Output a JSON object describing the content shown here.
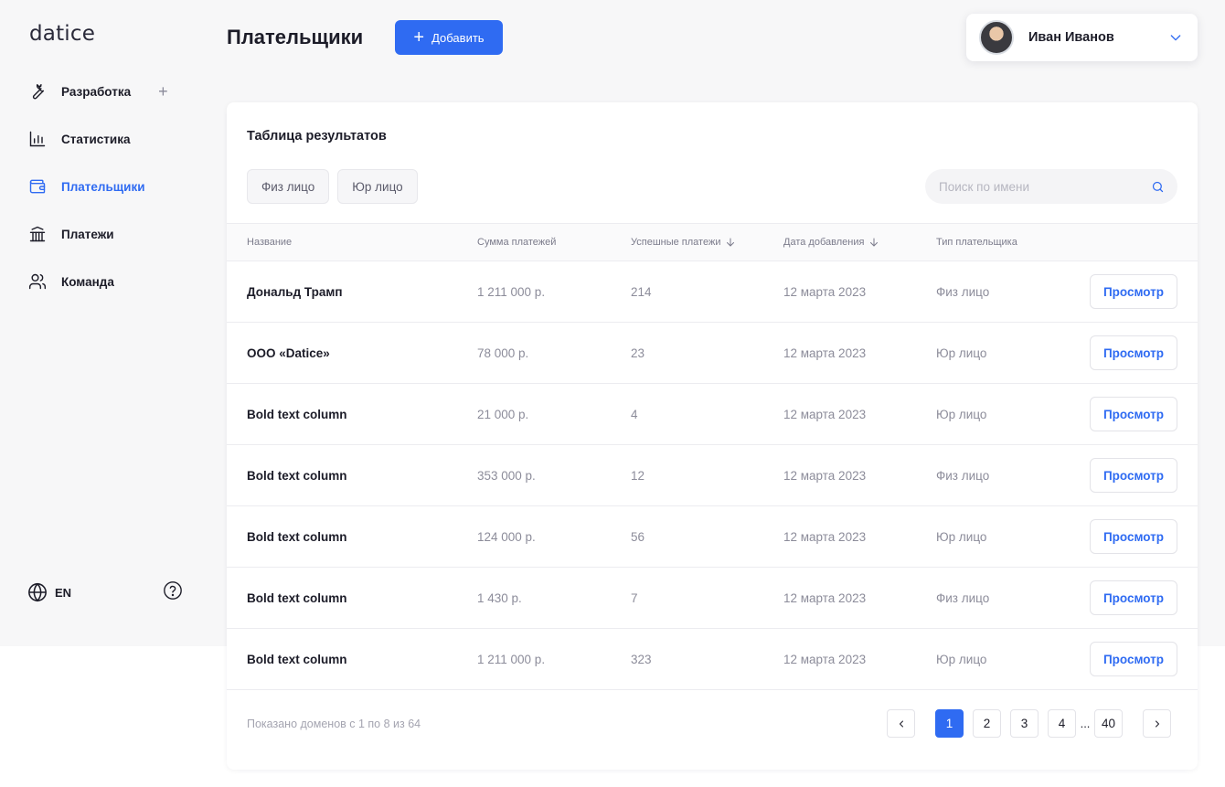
{
  "logo": "datice",
  "nav": {
    "items": [
      {
        "label": "Разработка",
        "icon": "wrench-icon"
      },
      {
        "label": "Статистика",
        "icon": "bar-chart-icon"
      },
      {
        "label": "Плательщики",
        "icon": "wallet-icon",
        "active": true
      },
      {
        "label": "Платежи",
        "icon": "bank-icon"
      },
      {
        "label": "Команда",
        "icon": "team-icon"
      }
    ],
    "add_symbol": "+"
  },
  "sidebar_bottom": {
    "language": "EN"
  },
  "header": {
    "title": "Плательщики",
    "add_button": "Добавить",
    "add_symbol": "+"
  },
  "user": {
    "name": "Иван Иванов"
  },
  "card": {
    "title": "Таблица результатов",
    "filters": [
      "Физ лицо",
      "Юр лицо"
    ],
    "search_placeholder": "Поиск по имени"
  },
  "table": {
    "columns": [
      "Название",
      "Сумма платежей",
      "Успешные платежи",
      "Дата добавления",
      "Тип плательщика"
    ],
    "view_label": "Просмотр",
    "rows": [
      {
        "name": "Дональд Трамп",
        "sum": "1 211 000 р.",
        "success": "214",
        "date": "12 марта 2023",
        "type": "Физ лицо"
      },
      {
        "name": "ООО «Datice»",
        "sum": "78 000 р.",
        "success": "23",
        "date": "12 марта 2023",
        "type": "Юр лицо"
      },
      {
        "name": "Bold text column",
        "sum": "21 000 р.",
        "success": "4",
        "date": "12 марта 2023",
        "type": "Юр лицо"
      },
      {
        "name": "Bold text column",
        "sum": "353 000 р.",
        "success": "12",
        "date": "12 марта 2023",
        "type": "Физ лицо"
      },
      {
        "name": "Bold text column",
        "sum": "124 000 р.",
        "success": "56",
        "date": "12 марта 2023",
        "type": "Юр лицо"
      },
      {
        "name": "Bold text column",
        "sum": "1 430 р.",
        "success": "7",
        "date": "12 марта 2023",
        "type": "Физ лицо"
      },
      {
        "name": "Bold text column",
        "sum": "1 211 000 р.",
        "success": "323",
        "date": "12 марта 2023",
        "type": "Юр лицо"
      }
    ]
  },
  "footer": {
    "note": "Показано доменов с 1 по 8 из  64",
    "pages": [
      "1",
      "2",
      "3",
      "4"
    ],
    "ellipsis": "...",
    "last_page": "40",
    "current_page": "1"
  },
  "colors": {
    "accent": "#2f6bf2",
    "background": "#f7f7f8",
    "text": "#1c1c28",
    "muted": "#8c8c9a"
  }
}
